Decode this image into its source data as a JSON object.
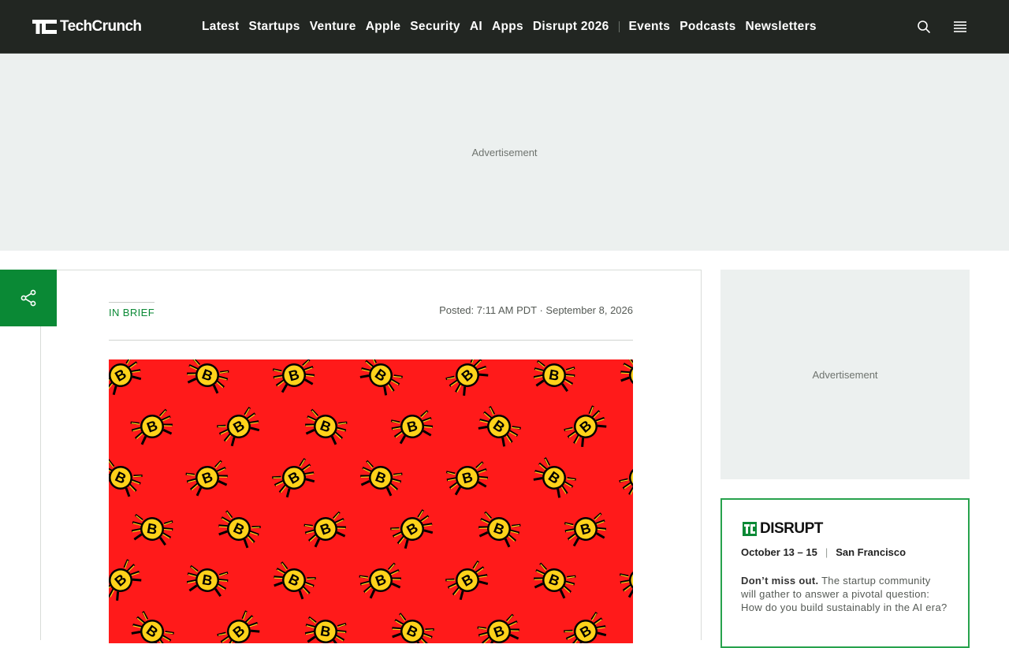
{
  "header": {
    "logo_text": "TechCrunch",
    "nav": [
      {
        "label": "Latest"
      },
      {
        "label": "Startups"
      },
      {
        "label": "Venture"
      },
      {
        "label": "Apple"
      },
      {
        "label": "Security"
      },
      {
        "label": "AI"
      },
      {
        "label": "Apps"
      },
      {
        "label": "Disrupt 2026"
      }
    ],
    "nav_secondary": [
      {
        "label": "Events"
      },
      {
        "label": "Podcasts"
      },
      {
        "label": "Newsletters"
      }
    ],
    "icons": {
      "search": "search-icon",
      "menu": "menu-icon"
    }
  },
  "ads": {
    "top_label": "Advertisement",
    "side_label": "Advertisement"
  },
  "article": {
    "kicker": "IN BRIEF",
    "posted": "Posted: 7:11 AM PDT · September 8, 2026",
    "hero_alt": "B",
    "share_icon": "share-icon"
  },
  "promo": {
    "logo_text": "DISRUPT",
    "dates": "October 13 – 15",
    "separator": "|",
    "city": "San Francisco",
    "lead": "Don’t miss out.",
    "body": " The startup community will gather to answer a pivotal question: How do you build sustainably in the AI era?"
  },
  "colors": {
    "header_bg": "#222622",
    "accent_green": "#0a8935",
    "promo_border": "#27a24c",
    "hero_red": "#ff1a1a",
    "coin_yellow": "#ffd21a"
  }
}
